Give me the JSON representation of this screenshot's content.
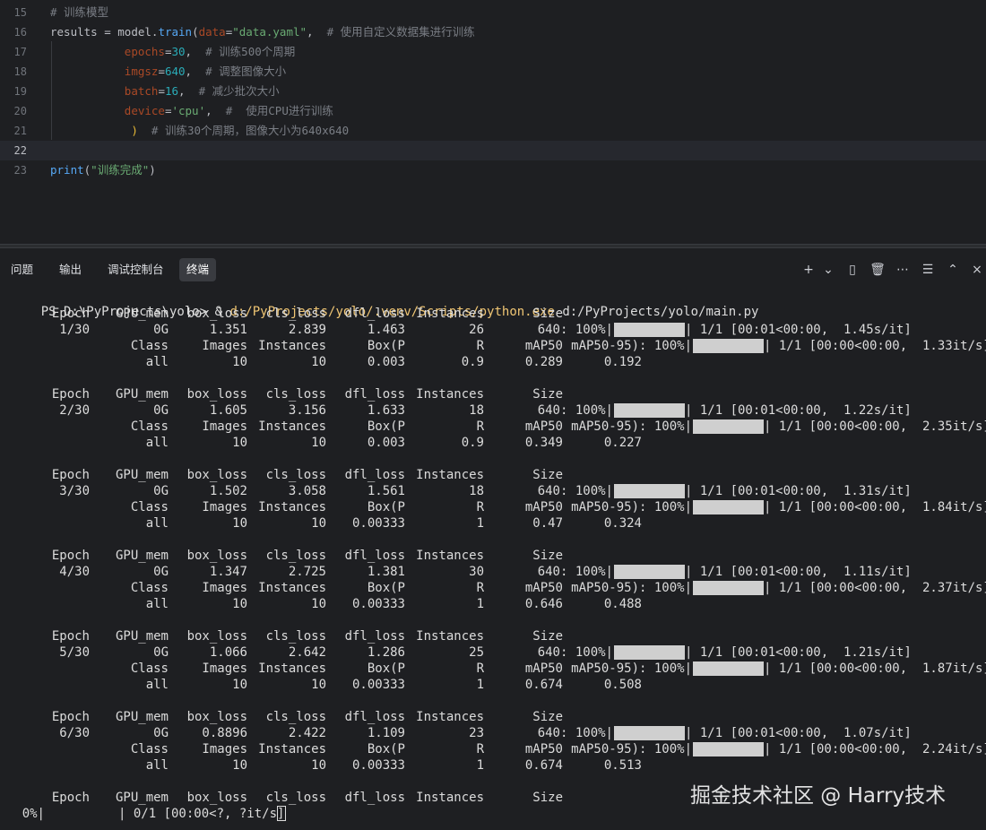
{
  "editor": {
    "lines": [
      {
        "n": "15",
        "parts": [
          {
            "t": "# 训练模型",
            "c": "cm"
          }
        ]
      },
      {
        "n": "16",
        "parts": [
          {
            "t": "results",
            "c": "plain"
          },
          {
            "t": " = ",
            "c": "plain"
          },
          {
            "t": "model",
            "c": "plain"
          },
          {
            "t": ".",
            "c": "plain"
          },
          {
            "t": "train",
            "c": "fn"
          },
          {
            "t": "(",
            "c": "plain"
          },
          {
            "t": "data",
            "c": "kw-arg"
          },
          {
            "t": "=",
            "c": "plain"
          },
          {
            "t": "\"data.yaml\"",
            "c": "str"
          },
          {
            "t": ",  ",
            "c": "plain"
          },
          {
            "t": "# 使用自定义数据集进行训练",
            "c": "cm"
          }
        ]
      },
      {
        "n": "17",
        "parts": [
          {
            "t": "           ",
            "c": "plain"
          },
          {
            "t": "epochs",
            "c": "kw-arg"
          },
          {
            "t": "=",
            "c": "plain"
          },
          {
            "t": "30",
            "c": "num"
          },
          {
            "t": ",  ",
            "c": "plain"
          },
          {
            "t": "# 训练500个周期",
            "c": "cm"
          }
        ]
      },
      {
        "n": "18",
        "parts": [
          {
            "t": "           ",
            "c": "plain"
          },
          {
            "t": "imgsz",
            "c": "kw-arg"
          },
          {
            "t": "=",
            "c": "plain"
          },
          {
            "t": "640",
            "c": "num"
          },
          {
            "t": ",  ",
            "c": "plain"
          },
          {
            "t": "# 调整图像大小",
            "c": "cm"
          }
        ]
      },
      {
        "n": "19",
        "parts": [
          {
            "t": "           ",
            "c": "plain"
          },
          {
            "t": "batch",
            "c": "kw-arg"
          },
          {
            "t": "=",
            "c": "plain"
          },
          {
            "t": "16",
            "c": "num"
          },
          {
            "t": ",  ",
            "c": "plain"
          },
          {
            "t": "# 减少批次大小",
            "c": "cm"
          }
        ]
      },
      {
        "n": "20",
        "parts": [
          {
            "t": "           ",
            "c": "plain"
          },
          {
            "t": "device",
            "c": "kw-arg"
          },
          {
            "t": "=",
            "c": "plain"
          },
          {
            "t": "'cpu'",
            "c": "str"
          },
          {
            "t": ",  ",
            "c": "plain"
          },
          {
            "t": "#  使用CPU进行训练",
            "c": "cm"
          }
        ]
      },
      {
        "n": "21",
        "parts": [
          {
            "t": "            ",
            "c": "plain"
          },
          {
            "t": ")",
            "c": "bracket"
          },
          {
            "t": "  ",
            "c": "plain"
          },
          {
            "t": "# 训练30个周期，图像大小为640x640",
            "c": "cm"
          }
        ]
      },
      {
        "n": "22",
        "parts": [],
        "current": true
      },
      {
        "n": "23",
        "parts": [
          {
            "t": "print",
            "c": "fn"
          },
          {
            "t": "(",
            "c": "plain"
          },
          {
            "t": "\"训练完成\"",
            "c": "str"
          },
          {
            "t": ")",
            "c": "plain"
          }
        ]
      }
    ]
  },
  "panel": {
    "tabs": [
      "问题",
      "输出",
      "调试控制台",
      "终端"
    ],
    "active_tab": "终端",
    "actions": [
      {
        "name": "add-terminal-icon",
        "glyph": "+"
      },
      {
        "name": "chevron-down-icon",
        "glyph": "⌄"
      },
      {
        "name": "split-terminal-icon",
        "glyph": "▯"
      },
      {
        "name": "trash-icon",
        "glyph": "🗑"
      },
      {
        "name": "more-icon",
        "glyph": "⋯"
      },
      {
        "name": "settings-sliders-icon",
        "glyph": "☰"
      },
      {
        "name": "chevron-up-icon",
        "glyph": "⌃"
      },
      {
        "name": "close-icon",
        "glyph": "×"
      }
    ]
  },
  "terminal": {
    "prompt": "PS D:\\PyProjects\\yolo> ",
    "command_amp": "& ",
    "command_exe": "d:/PyProjects/yolo/.venv/Scripts/python.exe",
    "command_arg": " d:/PyProjects/yolo/main.py",
    "train_header": [
      "Epoch",
      "GPU_mem",
      "box_loss",
      "cls_loss",
      "dfl_loss",
      "Instances",
      "Size"
    ],
    "val_header": [
      "Class",
      "Images",
      "Instances",
      "Box(P",
      "R",
      "mAP50",
      "mAP50-95): 100%|"
    ],
    "epochs": [
      {
        "epoch": "1/30",
        "gpu": "0G",
        "box": "1.351",
        "cls": "2.839",
        "dfl": "1.463",
        "inst": "26",
        "size": "640: 100%|",
        "train_tail": "| 1/1 [00:01<00:00,  1.45s/it]",
        "val_tail": "| 1/1 [00:00<00:00,  1.33it/s]",
        "cls_name": "all",
        "images": "10",
        "vinst": "10",
        "p": "0.003",
        "r": "0.9",
        "map50": "0.289",
        "map": "0.192"
      },
      {
        "epoch": "2/30",
        "gpu": "0G",
        "box": "1.605",
        "cls": "3.156",
        "dfl": "1.633",
        "inst": "18",
        "size": "640: 100%|",
        "train_tail": "| 1/1 [00:01<00:00,  1.22s/it]",
        "val_tail": "| 1/1 [00:00<00:00,  2.35it/s]",
        "cls_name": "all",
        "images": "10",
        "vinst": "10",
        "p": "0.003",
        "r": "0.9",
        "map50": "0.349",
        "map": "0.227"
      },
      {
        "epoch": "3/30",
        "gpu": "0G",
        "box": "1.502",
        "cls": "3.058",
        "dfl": "1.561",
        "inst": "18",
        "size": "640: 100%|",
        "train_tail": "| 1/1 [00:01<00:00,  1.31s/it]",
        "val_tail": "| 1/1 [00:00<00:00,  1.84it/s]",
        "cls_name": "all",
        "images": "10",
        "vinst": "10",
        "p": "0.00333",
        "r": "1",
        "map50": "0.47",
        "map": "0.324"
      },
      {
        "epoch": "4/30",
        "gpu": "0G",
        "box": "1.347",
        "cls": "2.725",
        "dfl": "1.381",
        "inst": "30",
        "size": "640: 100%|",
        "train_tail": "| 1/1 [00:01<00:00,  1.11s/it]",
        "val_tail": "| 1/1 [00:00<00:00,  2.37it/s]",
        "cls_name": "all",
        "images": "10",
        "vinst": "10",
        "p": "0.00333",
        "r": "1",
        "map50": "0.646",
        "map": "0.488"
      },
      {
        "epoch": "5/30",
        "gpu": "0G",
        "box": "1.066",
        "cls": "2.642",
        "dfl": "1.286",
        "inst": "25",
        "size": "640: 100%|",
        "train_tail": "| 1/1 [00:01<00:00,  1.21s/it]",
        "val_tail": "| 1/1 [00:00<00:00,  1.87it/s]",
        "cls_name": "all",
        "images": "10",
        "vinst": "10",
        "p": "0.00333",
        "r": "1",
        "map50": "0.674",
        "map": "0.508"
      },
      {
        "epoch": "6/30",
        "gpu": "0G",
        "box": "0.8896",
        "cls": "2.422",
        "dfl": "1.109",
        "inst": "23",
        "size": "640: 100%|",
        "train_tail": "| 1/1 [00:01<00:00,  1.07s/it]",
        "val_tail": "| 1/1 [00:00<00:00,  2.24it/s]",
        "cls_name": "all",
        "images": "10",
        "vinst": "10",
        "p": "0.00333",
        "r": "1",
        "map50": "0.674",
        "map": "0.513"
      }
    ],
    "progress_pct": "0%|",
    "progress_tail": "| 0/1 [00:00<?, ?it/s]"
  },
  "watermark": "掘金技术社区 @ Harry技术"
}
